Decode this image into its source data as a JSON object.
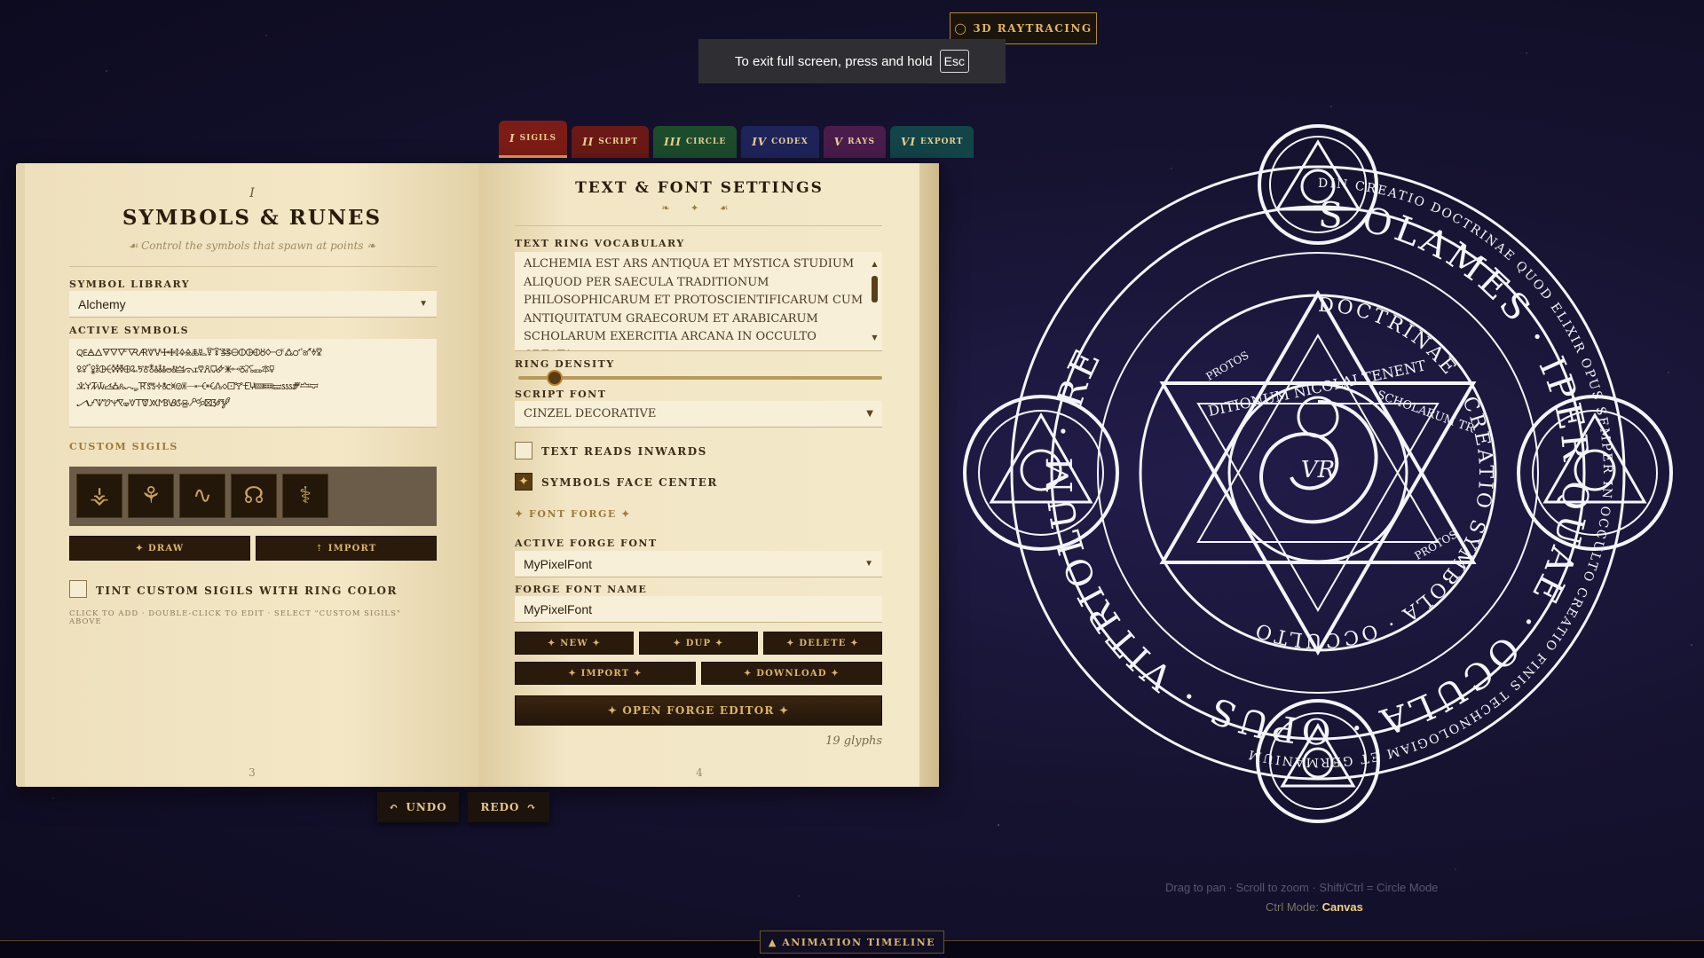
{
  "topbar": {
    "raytracing_label": "3D RAYTRACING",
    "fullscreen_msg": "To exit full screen, press and hold",
    "fullscreen_key": "Esc"
  },
  "tabs": [
    {
      "num": "I",
      "label": "SIGILS"
    },
    {
      "num": "II",
      "label": "SCRIPT"
    },
    {
      "num": "III",
      "label": "CIRCLE"
    },
    {
      "num": "IV",
      "label": "CODEX"
    },
    {
      "num": "V",
      "label": "RAYS"
    },
    {
      "num": "VI",
      "label": "EXPORT"
    }
  ],
  "left_page": {
    "chapter_num": "I",
    "title": "SYMBOLS & RUNES",
    "subtitle": "Control the symbols that spawn at points",
    "symbol_library_label": "SYMBOL LIBRARY",
    "symbol_library_value": "Alchemy",
    "active_symbols_label": "ACTIVE SYMBOLS",
    "active_symbols_lines": [
      "🜀🜁🜂🜃🜄🜅🜆🜇🜈🜉🜊🜋🜌🜍🜎🜏🜐🜑🜒🜓🜔🜕🜖🜗🜘🜙🜚🜛🜜🜝🜞🜟",
      "🜠🜡🜢🜣🜤🜥🜦🜧🜨🜩🜪🜫🜬🜭🜮🜯🜰🜱🜲🜳🜴🜵🜶🜷🜸🜹🜺🜻🜼🜽🜾🜿",
      "🝀🝁🝂🝃🝄🝅🝆🝇🝈🝉🝊🝋🝌🝍🝎🝏🝐🝑🝒🝓🝔🝕🝖🝗🝘🝙🝚🝛🝜🝝🝞🝟",
      "🝠🝡🝢🝣🝤🝥🝦🝧🝨🝩🝪🝫🝬🝭🝮🝯🝰🝱🝲🝳"
    ],
    "custom_sigils_label": "CUSTOM SIGILS",
    "sigils": [
      "⚶",
      "⚘",
      "∿",
      "☊",
      "⚕"
    ],
    "draw_label": "✦ DRAW",
    "import_label": "⇡ IMPORT",
    "tint_label": "TINT CUSTOM SIGILS WITH RING COLOR",
    "hint": "CLICK TO ADD · DOUBLE-CLICK TO EDIT · SELECT \"CUSTOM SIGILS\" ABOVE",
    "page_number": "3"
  },
  "right_page": {
    "title": "TEXT & FONT SETTINGS",
    "ornament": "❧ ✦ ☙",
    "vocab_label": "TEXT RING VOCABULARY",
    "vocab_text": "ALCHEMIA EST ARS ANTIQUA ET MYSTICA STUDIUM ALIQUOD PER SAECULA TRADITIONUM PHILOSOPHICARUM ET PROTOSCIENTIFICARUM CUM ANTIQUITATUM GRAECORUM ET ARABICARUM SCHOLARUM EXERCITIA ARCANA IN OCCULTO CREATA",
    "ring_density_label": "RING DENSITY",
    "ring_density_value": 0.1,
    "script_font_label": "SCRIPT FONT",
    "script_font_value": "CINZEL DECORATIVE",
    "text_inwards_label": "TEXT READS INWARDS",
    "symbols_center_label": "SYMBOLS FACE CENTER",
    "font_forge_label": "✦ FONT FORGE ✦",
    "active_forge_label": "ACTIVE FORGE FONT",
    "active_forge_value": "MyPixelFont",
    "forge_name_label": "FORGE FONT NAME",
    "forge_name_value": "MyPixelFont",
    "btn_new": "✦ NEW ✦",
    "btn_dup": "✦ DUP ✦",
    "btn_delete": "✦ DELETE ✦",
    "btn_import": "✦ IMPORT ✦",
    "btn_download": "✦ DOWNLOAD ✦",
    "btn_open_editor": "✦ OPEN FORGE EDITOR ✦",
    "glyph_count": "19 glyphs",
    "page_number": "4"
  },
  "history": {
    "undo_label": "UNDO",
    "redo_label": "REDO"
  },
  "canvas": {
    "ring_outer_text": "DIN CREATIO DOCTRINAE QUOD ELIXIR OPUS SEMPER IN OCCULTO CREATIO FINIS TECHNOLOGIAM ET GERMANIUM",
    "ring_mid_text": "S OLAMES · IPER QUAE · OCULA · OPUS · VITRIOLUM · RE",
    "ring_inner_text": "DOCTRINAE · CREATIO SYMBOLA · OCCULTO",
    "hex_text_top": "DITIONUM NICOLAI TENENT",
    "hex_text_right": "SCHOLARUM TR",
    "star_text_a": "PROTOS",
    "star_text_b": "PROTOS",
    "center_mark": "VR",
    "help_text": "Drag to pan · Scroll to zoom · Shift/Ctrl = Circle Mode",
    "ctrl_mode_label": "Ctrl Mode:",
    "ctrl_mode_value": "Canvas"
  },
  "timeline": {
    "label": "▲ ANIMATION TIMELINE"
  }
}
